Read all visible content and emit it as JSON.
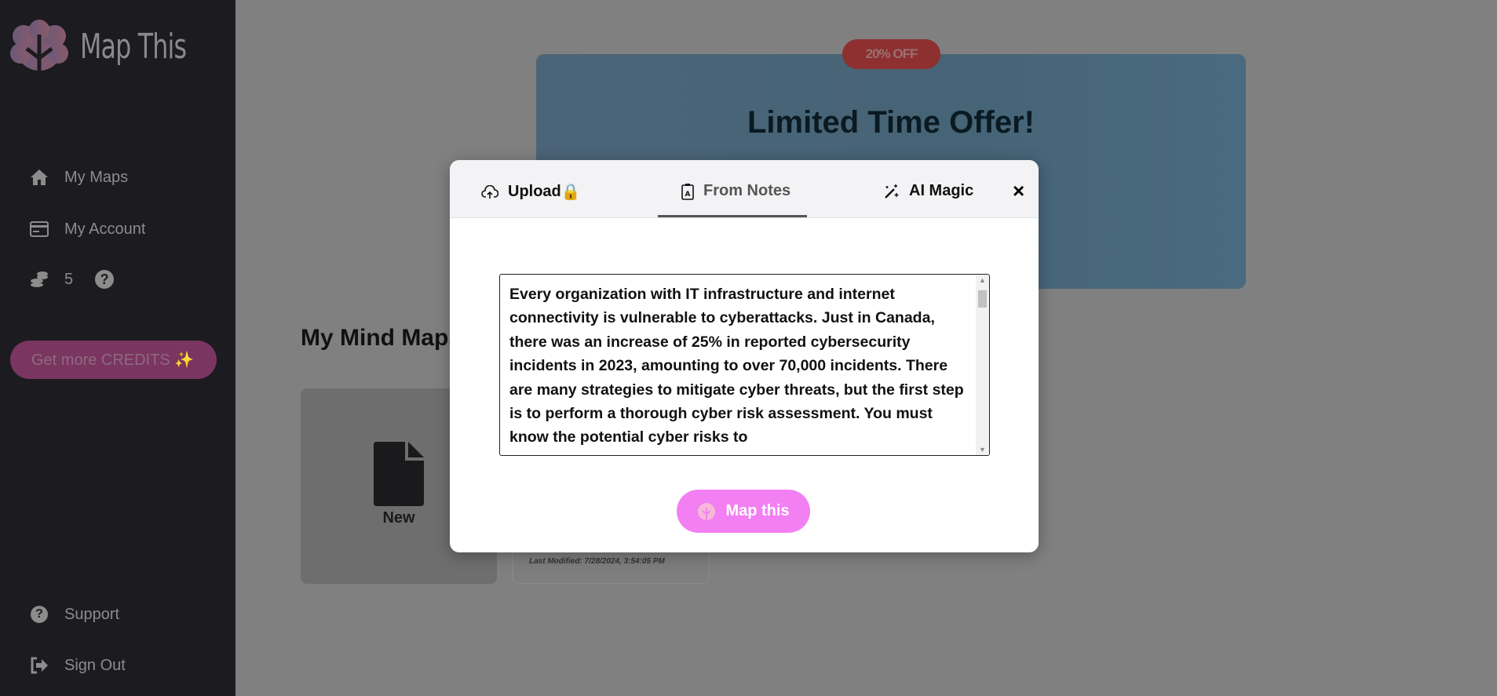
{
  "app": {
    "name": "Map This"
  },
  "sidebar": {
    "items": [
      {
        "label": "My Maps",
        "icon": "home-icon"
      },
      {
        "label": "My Account",
        "icon": "credit-card-icon"
      }
    ],
    "credits": {
      "count": "5",
      "icon": "coins-icon",
      "help_icon": "question-circle-icon"
    },
    "get_credits_label": "Get more CREDITS ✨",
    "bottom": [
      {
        "label": "Support",
        "icon": "question-circle-icon"
      },
      {
        "label": "Sign Out",
        "icon": "sign-out-icon"
      }
    ]
  },
  "banner": {
    "badge": "20% OFF",
    "title": "Limited Time Offer!"
  },
  "main": {
    "title": "My Mind Maps",
    "new_card_label": "New",
    "card_last_modified": "Last Modified: 7/28/2024, 3:54:05 PM"
  },
  "modal": {
    "tabs": [
      {
        "label": "Upload",
        "icon": "cloud-upload-icon",
        "badge": "🔒"
      },
      {
        "label": "From Notes",
        "icon": "clipboard-icon",
        "active": true
      },
      {
        "label": "AI Magic",
        "icon": "magic-wand-icon"
      }
    ],
    "close": "×",
    "notes_text": "Every organization with IT infrastructure and internet connectivity is vulnerable to cyberattacks. Just in Canada, there was an increase of 25% in reported cybersecurity incidents in 2023, amounting to over 70,000 incidents. There are many strategies to mitigate cyber threats, but the first step is to perform a thorough cyber risk assessment. You must know the potential cyber risks to",
    "submit_label": "Map this"
  },
  "colors": {
    "accent": "#f280f2",
    "sidebar": "#1c1b1f",
    "badge": "#8e2f30"
  }
}
